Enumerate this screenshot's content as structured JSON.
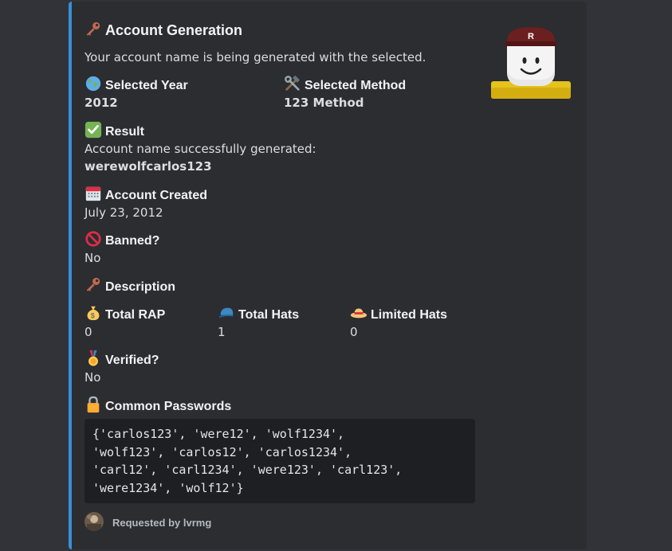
{
  "embed": {
    "title": "Account Generation",
    "description": "Your account name is being generated with the selected.",
    "accent_color": "#3a8fd8",
    "thumbnail": "roblox-avatar-icon"
  },
  "fields": {
    "selected_year": {
      "name": "Selected Year",
      "value": "2012",
      "icon": "globe-icon"
    },
    "selected_method": {
      "name": "Selected Method",
      "value": "123 Method",
      "icon": "hammer-wrench-icon"
    },
    "result": {
      "name": "Result",
      "line1": "Account name successfully generated:",
      "line2": "werewolfcarlos123",
      "icon": "check-mark-icon"
    },
    "account_created": {
      "name": "Account Created",
      "value": "July 23, 2012",
      "icon": "calendar-icon"
    },
    "banned": {
      "name": "Banned?",
      "value": "No",
      "icon": "prohibited-icon"
    },
    "description": {
      "name": "Description",
      "icon": "key-icon"
    },
    "total_rap": {
      "name": "Total RAP",
      "value": "0",
      "icon": "money-bag-icon"
    },
    "total_hats": {
      "name": "Total Hats",
      "value": "1",
      "icon": "cap-icon"
    },
    "limited_hats": {
      "name": "Limited Hats",
      "value": "0",
      "icon": "straw-hat-icon"
    },
    "verified": {
      "name": "Verified?",
      "value": "No",
      "icon": "medal-icon"
    },
    "common_passwords": {
      "name": "Common Passwords",
      "icon": "lock-icon",
      "lines": [
        "{'carlos123', 'were12', 'wolf1234',",
        "'wolf123', 'carlos12', 'carlos1234',",
        "'carl12', 'carl1234', 'were123', 'carl123',",
        "'were1234', 'wolf12'}"
      ]
    }
  },
  "footer": {
    "text": "Requested by lvrmg",
    "icon": "user-avatar-icon"
  }
}
